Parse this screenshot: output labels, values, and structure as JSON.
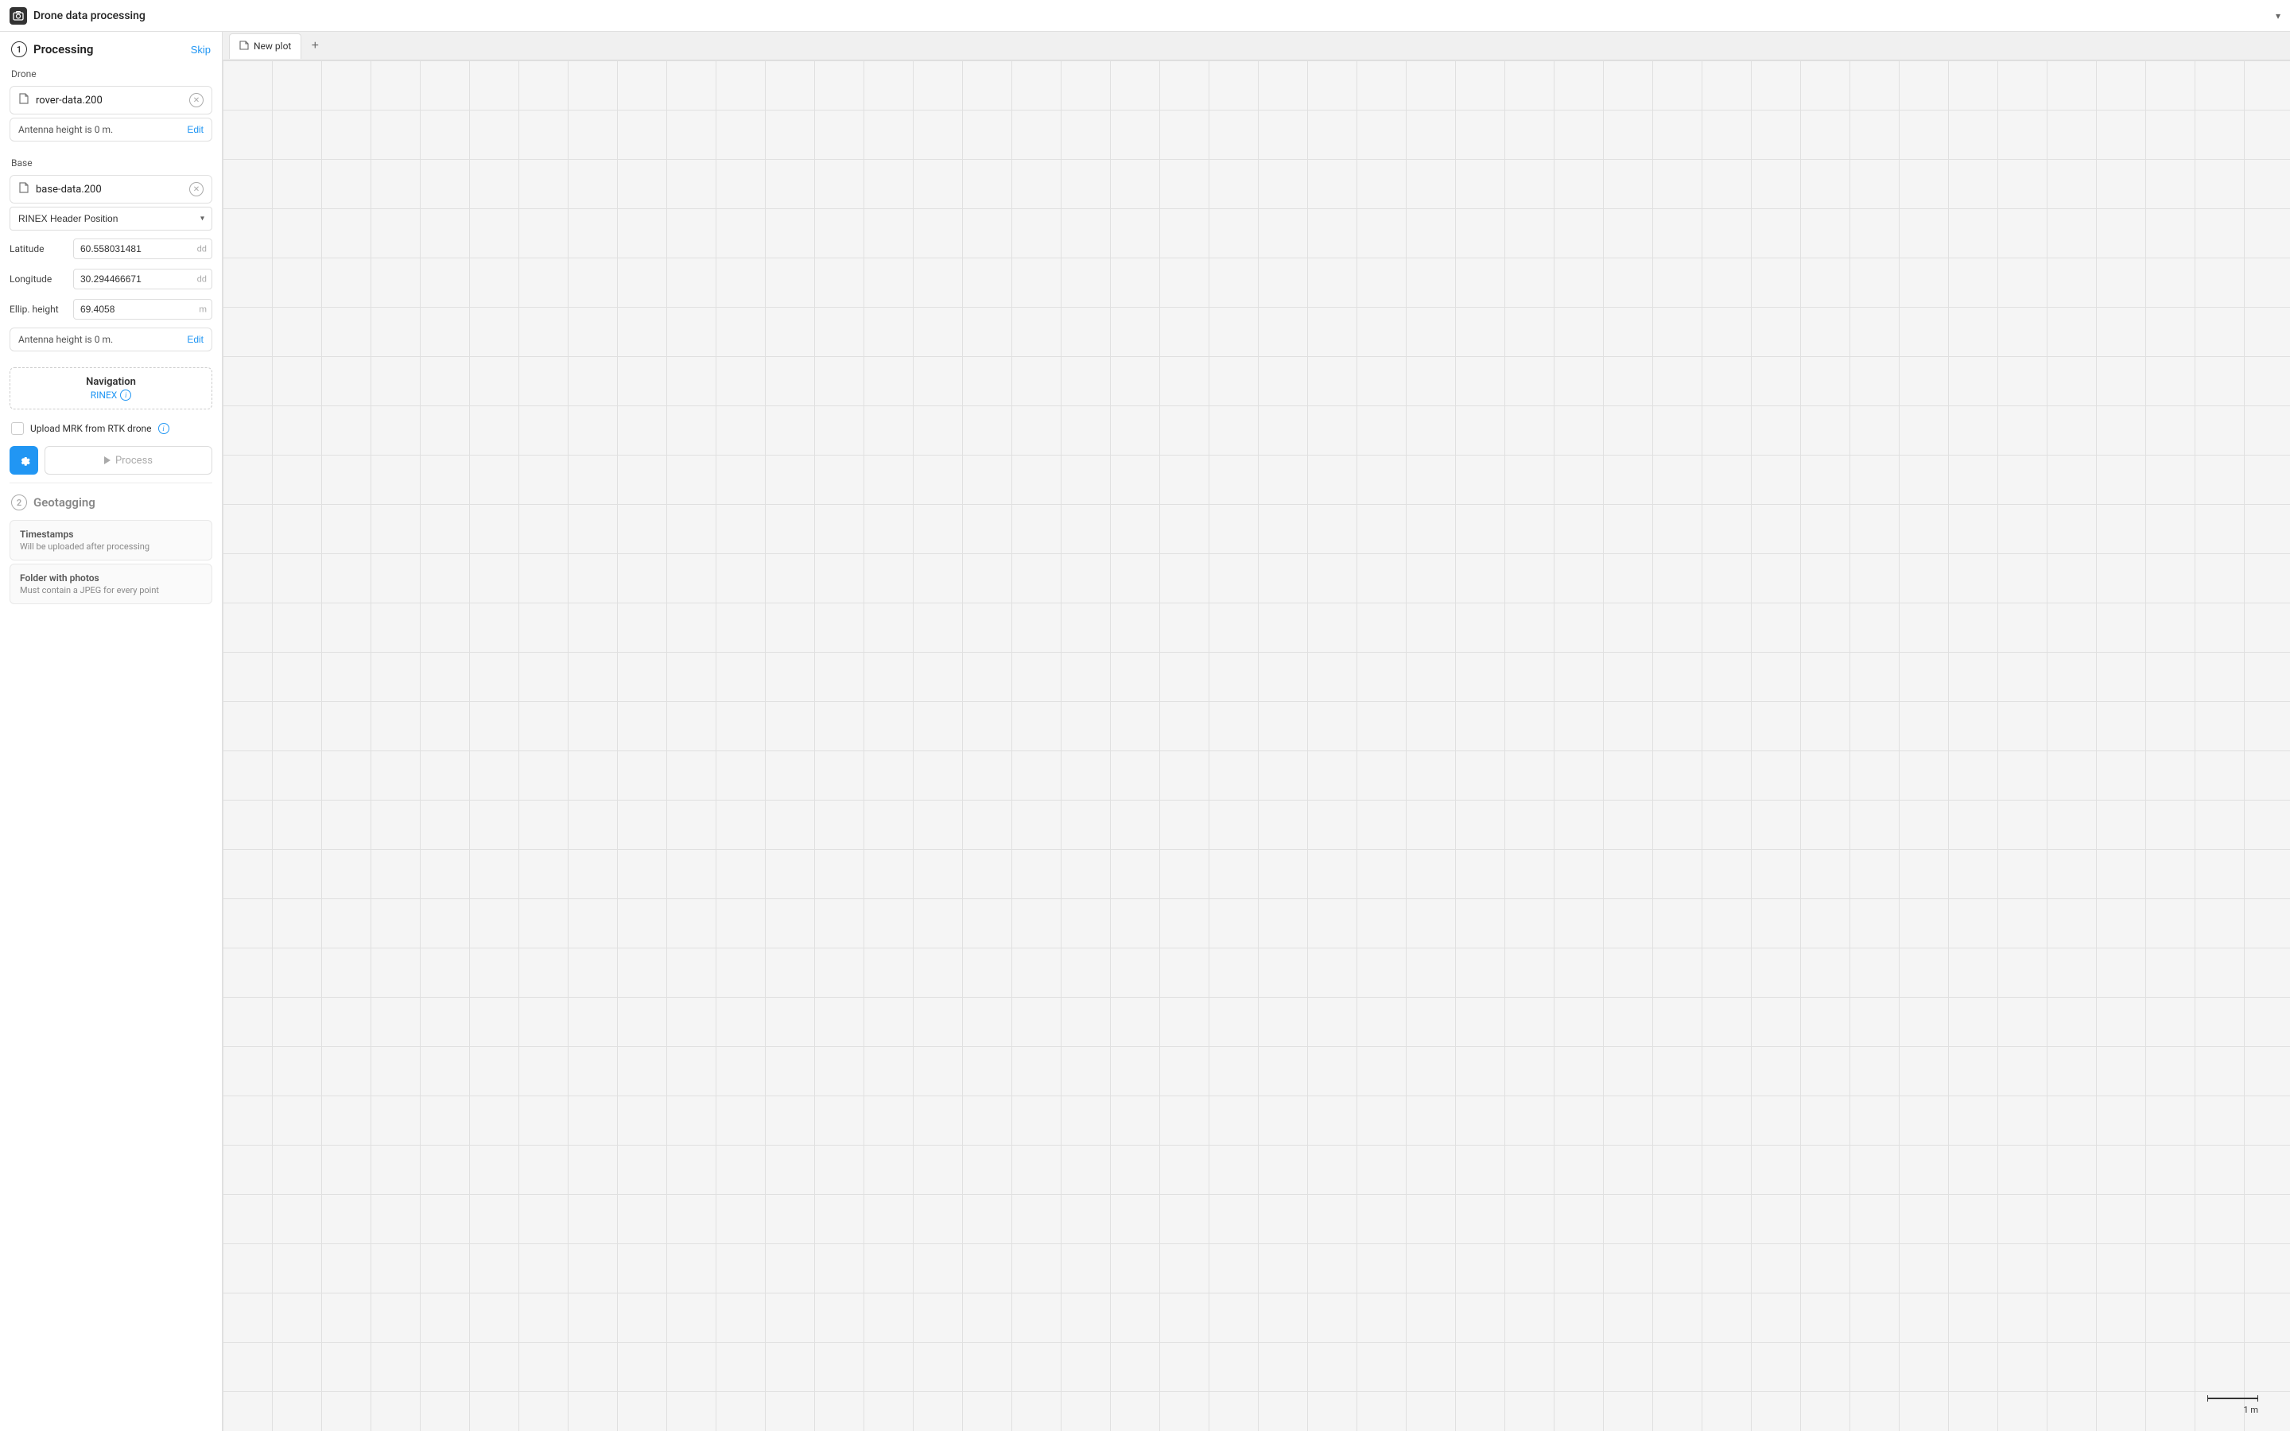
{
  "app": {
    "title": "Drone data processing",
    "title_icon": "📷"
  },
  "tabs": [
    {
      "label": "New plot",
      "icon": "📄",
      "active": true
    }
  ],
  "add_tab": "+",
  "sidebar": {
    "step1": {
      "number": "1",
      "title": "Processing",
      "skip_label": "Skip"
    },
    "drone": {
      "label": "Drone",
      "file": "rover-data.200",
      "antenna_text": "Antenna height is 0 m.",
      "edit_label": "Edit"
    },
    "base": {
      "label": "Base",
      "file": "base-data.200",
      "position_dropdown": "RINEX Header Position",
      "latitude_label": "Latitude",
      "latitude_value": "60.558031481",
      "latitude_unit": "dd",
      "longitude_label": "Longitude",
      "longitude_value": "30.294466671",
      "longitude_unit": "dd",
      "ellip_height_label": "Ellip. height",
      "ellip_height_value": "69.4058",
      "ellip_height_unit": "m",
      "antenna_text": "Antenna height is 0 m.",
      "edit_label": "Edit"
    },
    "navigation": {
      "title": "Navigation",
      "subtitle": "RINEX",
      "info_icon": "i"
    },
    "upload_mrk": {
      "label": "Upload MRK from RTK drone",
      "info_icon": "i"
    },
    "process": {
      "label": "Process"
    },
    "step2": {
      "number": "2",
      "title": "Geotagging"
    },
    "timestamps": {
      "title": "Timestamps",
      "subtitle": "Will be uploaded after processing"
    },
    "folder": {
      "title": "Folder with photos",
      "subtitle": "Must contain a JPEG for every point"
    }
  },
  "scale": {
    "label": "1 m"
  }
}
